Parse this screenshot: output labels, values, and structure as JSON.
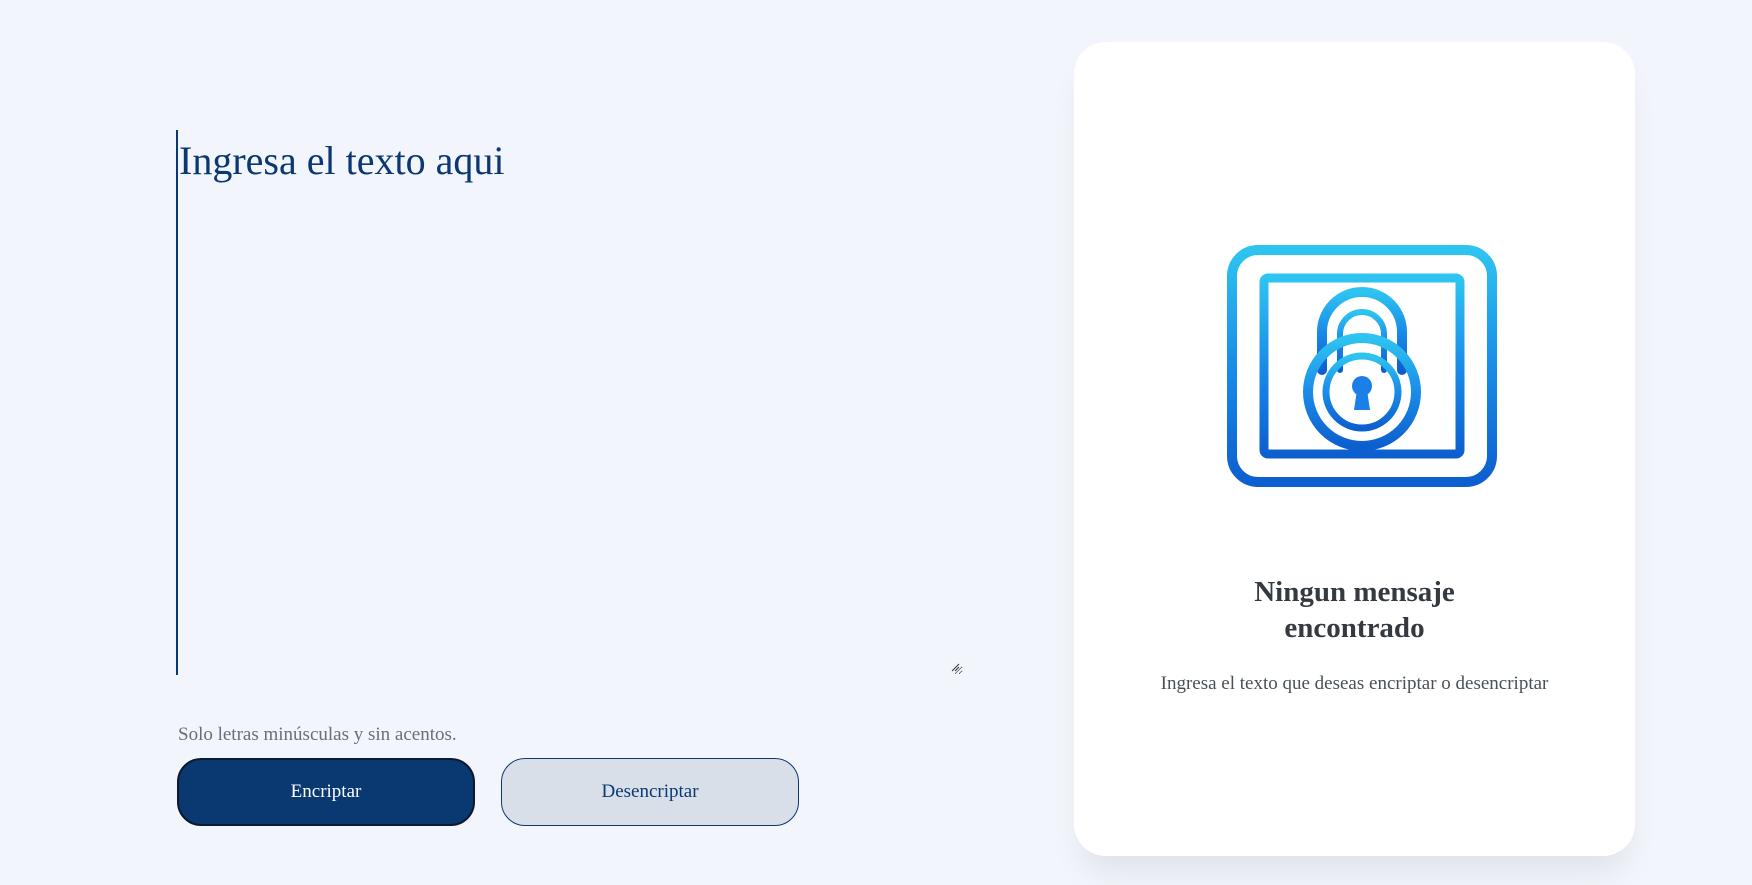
{
  "input": {
    "placeholder": "Ingresa el texto aqui",
    "hint": "Solo letras minúsculas y sin acentos."
  },
  "buttons": {
    "encrypt_label": "Encriptar",
    "decrypt_label": "Desencriptar"
  },
  "output": {
    "title_line1": "Ningun mensaje",
    "title_line2": "encontrado",
    "message": "Ingresa el texto que deseas encriptar o desencriptar",
    "illustration_icon": "chip-lock-icon"
  },
  "colors": {
    "background": "#f3f5fc",
    "primary": "#0a3871",
    "secondary": "#d8dfe8",
    "illustration_blue": "#1a7fe6"
  }
}
